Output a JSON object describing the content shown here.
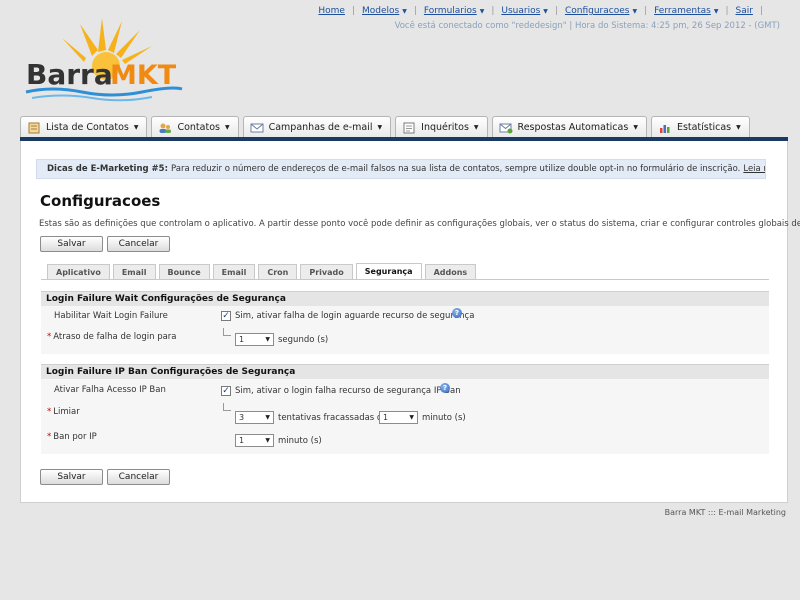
{
  "topnav": {
    "items": [
      {
        "label": "Home",
        "dropdown": false
      },
      {
        "label": "Modelos",
        "dropdown": true
      },
      {
        "label": "Formularios",
        "dropdown": true
      },
      {
        "label": "Usuarios",
        "dropdown": true
      },
      {
        "label": "Configuracoes",
        "dropdown": true
      },
      {
        "label": "Ferramentas",
        "dropdown": true
      },
      {
        "label": "Sair",
        "dropdown": false
      }
    ],
    "status": "Você está conectado como \"rededesign\" | Hora do Sistema: 4:25 pm, 26 Sep 2012 - (GMT)"
  },
  "logo": {
    "text_barra": "Barra",
    "text_mkt": "MKT"
  },
  "maintabs": [
    {
      "label": "Lista de Contatos",
      "icon": "contact-list-icon"
    },
    {
      "label": "Contatos",
      "icon": "contacts-icon"
    },
    {
      "label": "Campanhas de e-mail",
      "icon": "email-campaign-icon"
    },
    {
      "label": "Inquéritos",
      "icon": "surveys-icon"
    },
    {
      "label": "Respostas Automaticas",
      "icon": "autoresponder-icon"
    },
    {
      "label": "Estatísticas",
      "icon": "statistics-icon"
    }
  ],
  "tip": {
    "title": "Dicas de E-Marketing #5:",
    "text": "Para reduzir o número de endereços de e-mail falsos na sua lista de contatos, sempre utilize double opt-in no formulário de inscrição.",
    "link": "Leia mais..."
  },
  "page": {
    "title": "Configuracoes",
    "description": "Estas são as definições que controlam o aplicativo. A partir desse ponto você pode definir as configurações globais, ver o status do sistema, criar e configurar controles globais de e-mail."
  },
  "buttons": {
    "save": "Salvar",
    "cancel": "Cancelar"
  },
  "subtabs": [
    "Aplicativo",
    "Email",
    "Bounce",
    "Email",
    "Cron",
    "Privado",
    "Segurança",
    "Addons"
  ],
  "subtabs_active": "Segurança",
  "section1": {
    "title": "Login Failure Wait Configurações de Segurança",
    "enable_label": "Habilitar Wait Login Failure",
    "enable_checked": true,
    "enable_text": "Sim, ativar falha de login aguarde recurso de segurança",
    "delay_label": "Atraso de falha de login para",
    "delay_value": "1",
    "delay_unit": "segundo (s)"
  },
  "section2": {
    "title": "Login Failure IP Ban Configurações de Segurança",
    "enable_label": "Ativar Falha Acesso IP Ban",
    "enable_checked": true,
    "enable_text": "Sim, ativar o login falha recurso de segurança IP Ban",
    "threshold_label": "Limiar",
    "threshold_value": "3",
    "threshold_text": "tentativas fracassadas de",
    "threshold_minutes_value": "1",
    "threshold_minutes_unit": "minuto (s)",
    "ban_label": "Ban por IP",
    "ban_value": "1",
    "ban_unit": "minuto (s)"
  },
  "footer": "Barra MKT ::: E-mail Marketing",
  "colors": {
    "navbar": "#1b3a63",
    "link": "#1d4f9c",
    "tip_bg": "#e3ebf6",
    "required": "#cc0000"
  }
}
